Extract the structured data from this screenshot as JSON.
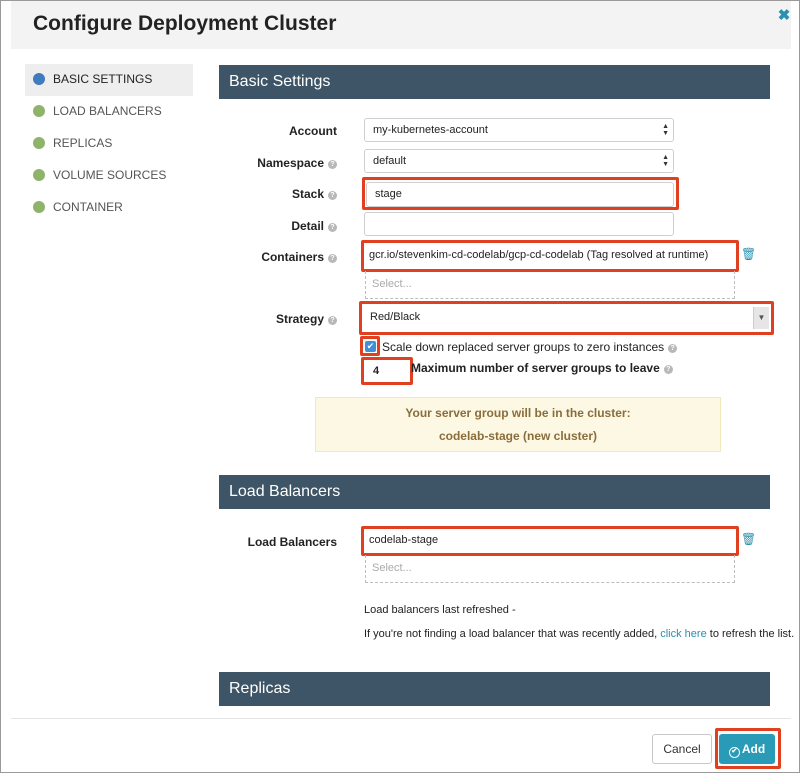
{
  "dialog": {
    "title": "Configure Deployment Cluster",
    "close_icon": "close-icon",
    "accent_color": "#3d5566",
    "highlight_color": "#e0401f"
  },
  "sidebar": {
    "items": [
      {
        "label": "BASIC SETTINGS",
        "active": true
      },
      {
        "label": "LOAD BALANCERS",
        "active": false
      },
      {
        "label": "REPLICAS",
        "active": false
      },
      {
        "label": "VOLUME SOURCES",
        "active": false
      },
      {
        "label": "CONTAINER",
        "active": false
      }
    ]
  },
  "basic_settings": {
    "header": "Basic Settings",
    "account": {
      "label": "Account",
      "value": "my-kubernetes-account"
    },
    "namespace": {
      "label": "Namespace",
      "value": "default"
    },
    "stack": {
      "label": "Stack",
      "value": "stage"
    },
    "detail": {
      "label": "Detail",
      "value": ""
    },
    "containers": {
      "label": "Containers",
      "value": "gcr.io/stevenkim-cd-codelab/gcp-cd-codelab (Tag resolved at runtime)",
      "placeholder": "Select..."
    },
    "strategy": {
      "label": "Strategy",
      "value": "Red/Black"
    },
    "scale_down": {
      "label": "Scale down replaced server groups to zero instances",
      "checked": true
    },
    "max_groups": {
      "label": "Maximum number of server groups to leave",
      "value": "4"
    },
    "info": {
      "line1": "Your server group will be in the cluster:",
      "line2": "codelab-stage (new cluster)"
    }
  },
  "load_balancers": {
    "header": "Load Balancers",
    "label": "Load Balancers",
    "value": "codelab-stage",
    "placeholder": "Select...",
    "refreshed": "Load balancers last refreshed -",
    "hint_before": "If you're not finding a load balancer that was recently added, ",
    "hint_link": "click here",
    "hint_after": " to refresh the list."
  },
  "replicas": {
    "header": "Replicas"
  },
  "footer": {
    "cancel": "Cancel",
    "add": "Add"
  }
}
